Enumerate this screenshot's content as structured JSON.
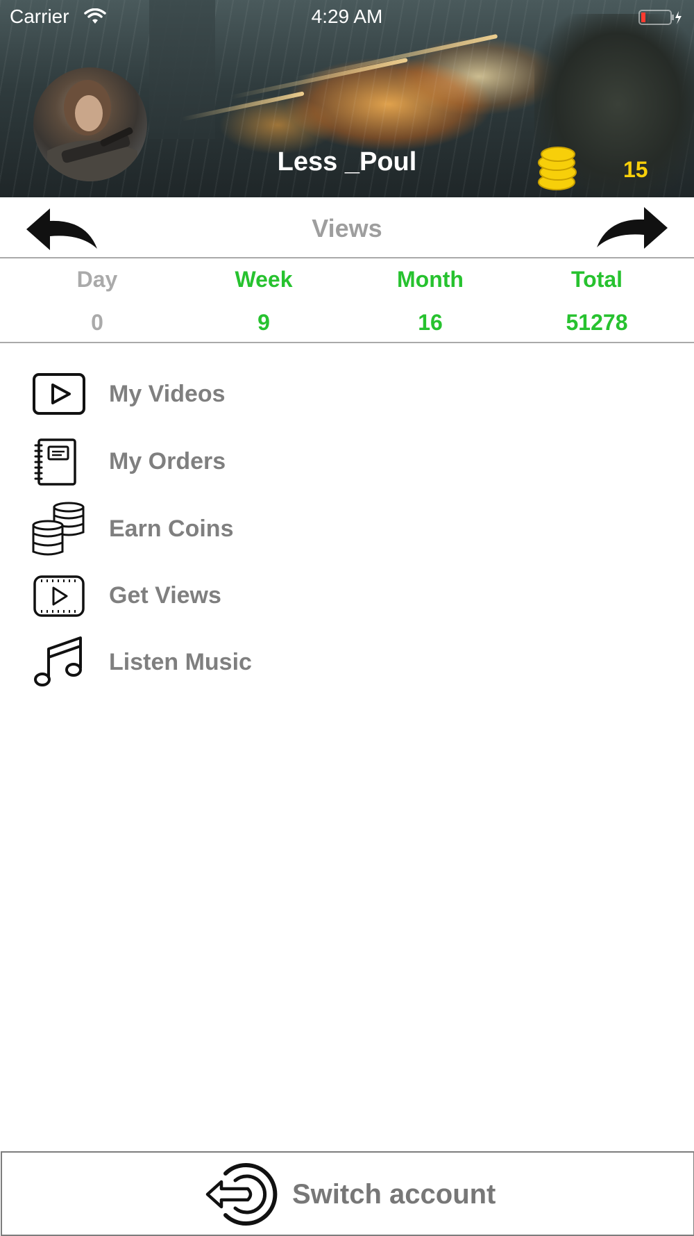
{
  "status_bar": {
    "carrier": "Carrier",
    "time": "4:29 AM"
  },
  "profile": {
    "username": "Less _Poul",
    "coins": "15"
  },
  "nav": {
    "title": "Views"
  },
  "stats": {
    "headers": [
      "Day",
      "Week",
      "Month",
      "Total"
    ],
    "values": [
      "0",
      "9",
      "16",
      "51278"
    ]
  },
  "menu": {
    "items": [
      {
        "label": "My Videos",
        "icon": "play-icon"
      },
      {
        "label": "My Orders",
        "icon": "notebook-icon"
      },
      {
        "label": "Earn Coins",
        "icon": "coins-icon"
      },
      {
        "label": "Get Views",
        "icon": "film-play-icon"
      },
      {
        "label": "Listen Music",
        "icon": "music-note-icon"
      }
    ]
  },
  "footer": {
    "switch_label": "Switch account"
  },
  "colors": {
    "accent_green": "#27c22f",
    "coin_yellow": "#f7cf0a",
    "label_grey": "#7f7f7f"
  }
}
